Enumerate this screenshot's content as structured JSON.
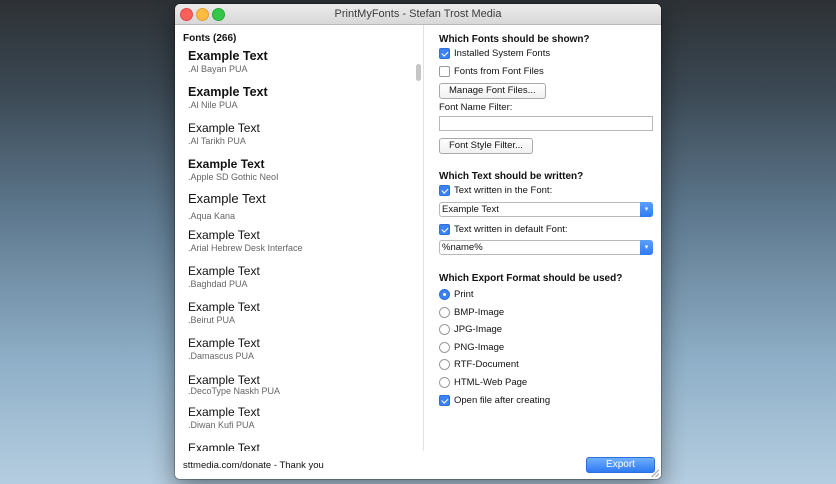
{
  "window": {
    "title": "PrintMyFonts - Stefan Trost Media"
  },
  "font_list": {
    "header": "Fonts (266)",
    "items": [
      {
        "example": "Example Text",
        "name": ".Al Bayan PUA",
        "bold": true
      },
      {
        "example": "Example Text",
        "name": ".Al Nile PUA",
        "bold": true
      },
      {
        "example": "Example Text",
        "name": ".Al Tarikh PUA",
        "bold": false
      },
      {
        "example": "Example Text",
        "name": ".Apple SD Gothic NeoI",
        "bold": true
      },
      {
        "example": "Example Text",
        "name": ".Aqua Kana",
        "bold": false
      },
      {
        "example": "Example Text",
        "name": ".Arial Hebrew Desk Interface",
        "bold": false
      },
      {
        "example": "Example Text",
        "name": ".Baghdad PUA",
        "bold": false
      },
      {
        "example": "Example Text",
        "name": ".Beirut PUA",
        "bold": false
      },
      {
        "example": "Example Text",
        "name": ".Damascus PUA",
        "bold": false
      },
      {
        "example": "Example Text",
        "name": ".DecoType Naskh PUA",
        "bold": false
      },
      {
        "example": "Example Text",
        "name": ".Diwan Kufi PUA",
        "bold": false
      },
      {
        "example": "Example Text",
        "name": "",
        "bold": false
      }
    ]
  },
  "fonts_shown": {
    "title": "Which Fonts should be shown?",
    "installed_label": "Installed System Fonts",
    "installed_checked": true,
    "from_files_label": "Fonts from Font Files",
    "from_files_checked": false,
    "manage_button": "Manage Font Files...",
    "filter_label": "Font Name Filter:",
    "filter_value": "",
    "style_filter_button": "Font Style Filter..."
  },
  "text_written": {
    "title": "Which Text should be written?",
    "in_font_label": "Text written in the Font:",
    "in_font_checked": true,
    "in_font_value": "Example Text",
    "default_font_label": "Text written in default Font:",
    "default_font_checked": true,
    "default_font_value": "%name%"
  },
  "export_format": {
    "title": "Which Export Format should be used?",
    "options": [
      "Print",
      "BMP-Image",
      "JPG-Image",
      "PNG-Image",
      "RTF-Document",
      "HTML-Web Page"
    ],
    "selected": "Print",
    "open_after_label": "Open file after creating",
    "open_after_checked": true
  },
  "footer": {
    "donate_text": "sttmedia.com/donate - Thank you",
    "export_button": "Export"
  },
  "colors": {
    "accent": "#3b82f6",
    "close": "#fc605c",
    "minimize": "#fdbc40",
    "maximize": "#34c84a"
  }
}
